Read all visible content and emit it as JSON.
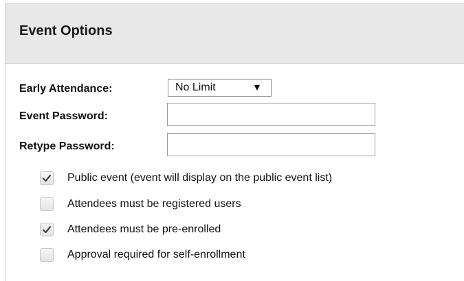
{
  "panel": {
    "title": "Event Options"
  },
  "fields": {
    "early_attendance": {
      "label": "Early Attendance:",
      "value": "No Limit"
    },
    "event_password": {
      "label": "Event Password:",
      "value": ""
    },
    "retype_password": {
      "label": "Retype Password:",
      "value": ""
    }
  },
  "checkboxes": [
    {
      "label": "Public event (event will display on the public event list)",
      "checked": true
    },
    {
      "label": "Attendees must be registered users",
      "checked": false
    },
    {
      "label": "Attendees must be pre-enrolled",
      "checked": true
    },
    {
      "label": "Approval required for self-enrollment",
      "checked": false
    }
  ],
  "icons": {
    "dropdown": "triangle-down-icon",
    "check": "checkmark-icon"
  }
}
